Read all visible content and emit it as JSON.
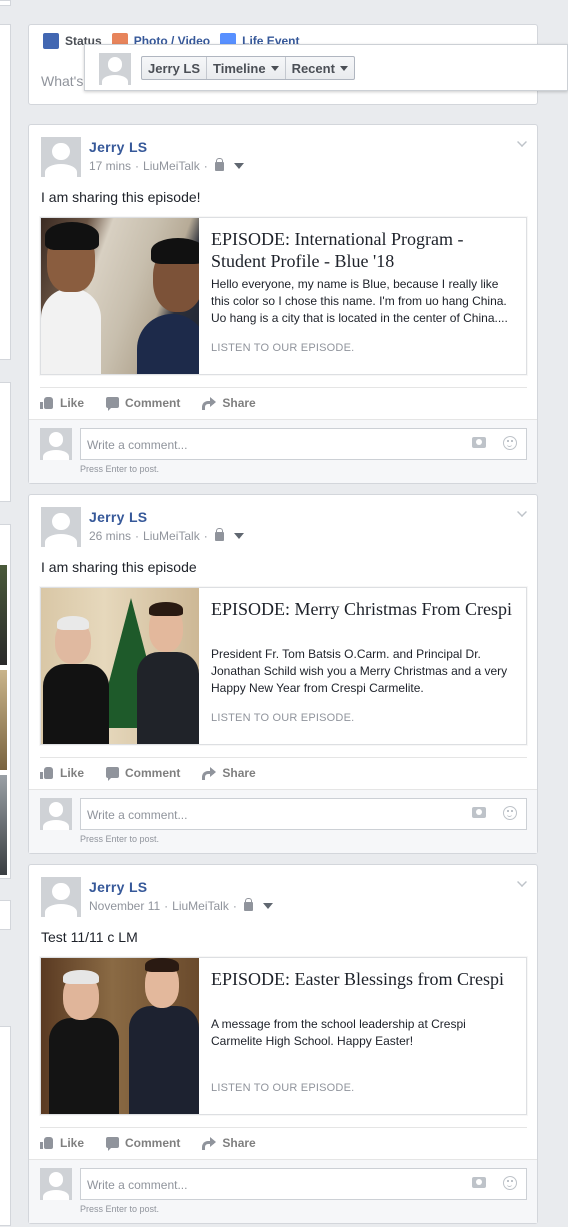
{
  "composer": {
    "tabs": [
      {
        "label": "Status",
        "icon": "pencil-icon",
        "color": "#4267b2"
      },
      {
        "label": "Photo / Video",
        "icon": "photo-icon",
        "color": "#e7845b"
      },
      {
        "label": "Life Event",
        "icon": "flag-icon",
        "color": "#5890ff"
      }
    ],
    "placeholder": "What's"
  },
  "audience": {
    "name": "Jerry LS",
    "timeline": "Timeline",
    "recent": "Recent"
  },
  "posts": [
    {
      "author": "Jerry LS",
      "time": "17 mins",
      "app": "LiuMeiTalk",
      "text": "I am sharing this episode!",
      "link": {
        "title": "EPISODE: International Program - Student Profile - Blue '18",
        "description": "Hello everyone, my name is Blue, because I really like this color so I chose this name. I'm from uo hang China. Uo hang is a city that is located in the center of China....",
        "cta": "LISTEN TO OUR EPISODE."
      }
    },
    {
      "author": "Jerry LS",
      "time": "26 mins",
      "app": "LiuMeiTalk",
      "text": "I am sharing this episode",
      "link": {
        "title": "EPISODE: Merry Christmas From Crespi",
        "description": "President Fr. Tom Batsis O.Carm. and Principal Dr. Jonathan Schild wish you a Merry Christmas and a very Happy New Year from Crespi Carmelite.",
        "cta": "LISTEN TO OUR EPISODE."
      }
    },
    {
      "author": "Jerry LS",
      "time": "November 11",
      "app": "LiuMeiTalk",
      "text": "Test 11/11 c LM",
      "link": {
        "title": "EPISODE: Easter Blessings from Crespi",
        "description": "A message from the school leadership at Crespi Carmelite High School. Happy Easter!",
        "cta": "LISTEN TO OUR EPISODE."
      }
    }
  ],
  "actions": {
    "like": "Like",
    "comment": "Comment",
    "share": "Share"
  },
  "comment_box": {
    "placeholder": "Write a comment...",
    "hint": "Press Enter to post."
  },
  "meta": {
    "separator": "·"
  }
}
